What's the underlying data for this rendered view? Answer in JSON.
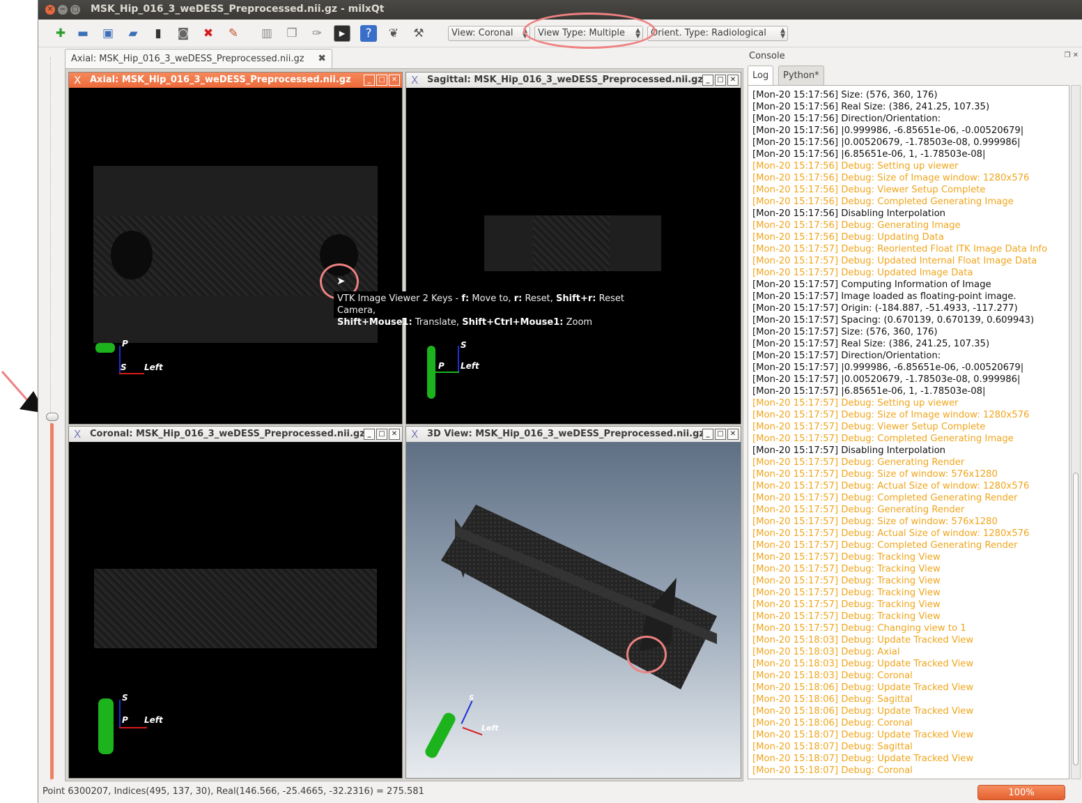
{
  "window": {
    "title": "MSK_Hip_016_3_weDESS_Preprocessed.nii.gz - milxQt"
  },
  "toolbar": {
    "view_combo": "View: Coronal",
    "view_type_combo": "View Type: Multiple",
    "orient_combo": "Orient. Type: Radiological"
  },
  "doc_tab": {
    "label": "Axial: MSK_Hip_016_3_weDESS_Preprocessed.nii.gz"
  },
  "panes": {
    "axial": {
      "title": "Axial: MSK_Hip_016_3_weDESS_Preprocessed.nii.gz",
      "lbl_top": "P",
      "lbl_left": "S",
      "lbl_right": "Left"
    },
    "sagittal": {
      "title": "Sagittal: MSK_Hip_016_3_weDESS_Preprocessed.nii.gz",
      "lbl_top": "S",
      "lbl_left": "P",
      "lbl_right": "Left"
    },
    "coronal": {
      "title": "Coronal: MSK_Hip_016_3_weDESS_Preprocessed.nii.gz",
      "lbl_top": "S",
      "lbl_left": "P",
      "lbl_right": "Left"
    },
    "view3d": {
      "title": "3D View: MSK_Hip_016_3_weDESS_Preprocessed.nii.gz",
      "lbl_top": "S",
      "lbl_right": "Left"
    }
  },
  "tooltip": {
    "p1": "VTK Image Viewer 2 Keys - ",
    "k1": "f:",
    "t1": " Move to, ",
    "k2": "r:",
    "t2": " Reset, ",
    "k3": "Shift+r:",
    "t3": " Reset Camera,",
    "k4": "Shift+Mouse1:",
    "t4": " Translate, ",
    "k5": "Shift+Ctrl+Mouse1:",
    "t5": " Zoom"
  },
  "console": {
    "title": "Console",
    "tabs": [
      "Log",
      "Python*"
    ],
    "lines": [
      {
        "text": "[Mon-20 15:17:56] Size: (576, 360, 176)",
        "type": "info"
      },
      {
        "text": "[Mon-20 15:17:56] Real Size: (386, 241.25, 107.35)",
        "type": "info"
      },
      {
        "text": "[Mon-20 15:17:56] Direction/Orientation:",
        "type": "info"
      },
      {
        "text": "[Mon-20 15:17:56] |0.999986, -6.85651e-06, -0.00520679|",
        "type": "info"
      },
      {
        "text": "[Mon-20 15:17:56] |0.00520679, -1.78503e-08, 0.999986|",
        "type": "info"
      },
      {
        "text": "[Mon-20 15:17:56] |6.85651e-06, 1, -1.78503e-08|",
        "type": "info"
      },
      {
        "text": "[Mon-20 15:17:56] Debug: Setting up viewer",
        "type": "debug"
      },
      {
        "text": "[Mon-20 15:17:56] Debug: Size of Image window: 1280x576",
        "type": "debug"
      },
      {
        "text": "[Mon-20 15:17:56] Debug: Viewer Setup Complete",
        "type": "debug"
      },
      {
        "text": "[Mon-20 15:17:56] Debug: Completed Generating Image",
        "type": "debug"
      },
      {
        "text": "[Mon-20 15:17:56] Disabling Interpolation",
        "type": "info"
      },
      {
        "text": "[Mon-20 15:17:56] Debug: Generating Image",
        "type": "debug"
      },
      {
        "text": "[Mon-20 15:17:56] Debug: Updating Data",
        "type": "debug"
      },
      {
        "text": "[Mon-20 15:17:57] Debug: Reoriented Float ITK Image Data Info",
        "type": "debug"
      },
      {
        "text": "[Mon-20 15:17:57] Debug: Updated Internal Float Image Data",
        "type": "debug"
      },
      {
        "text": "[Mon-20 15:17:57] Debug: Updated Image Data",
        "type": "debug"
      },
      {
        "text": "[Mon-20 15:17:57] Computing Information of Image",
        "type": "info"
      },
      {
        "text": "[Mon-20 15:17:57] Image loaded as floating-point image.",
        "type": "info"
      },
      {
        "text": "[Mon-20 15:17:57] Origin: (-184.887, -51.4933, -117.277)",
        "type": "info"
      },
      {
        "text": "[Mon-20 15:17:57] Spacing: (0.670139, 0.670139, 0.609943)",
        "type": "info"
      },
      {
        "text": "[Mon-20 15:17:57] Size: (576, 360, 176)",
        "type": "info"
      },
      {
        "text": "[Mon-20 15:17:57] Real Size: (386, 241.25, 107.35)",
        "type": "info"
      },
      {
        "text": "[Mon-20 15:17:57] Direction/Orientation:",
        "type": "info"
      },
      {
        "text": "[Mon-20 15:17:57] |0.999986, -6.85651e-06, -0.00520679|",
        "type": "info"
      },
      {
        "text": "[Mon-20 15:17:57] |0.00520679, -1.78503e-08, 0.999986|",
        "type": "info"
      },
      {
        "text": "[Mon-20 15:17:57] |6.85651e-06, 1, -1.78503e-08|",
        "type": "info"
      },
      {
        "text": "[Mon-20 15:17:57] Debug: Setting up viewer",
        "type": "debug"
      },
      {
        "text": "[Mon-20 15:17:57] Debug: Size of Image window: 1280x576",
        "type": "debug"
      },
      {
        "text": "[Mon-20 15:17:57] Debug: Viewer Setup Complete",
        "type": "debug"
      },
      {
        "text": "[Mon-20 15:17:57] Debug: Completed Generating Image",
        "type": "debug"
      },
      {
        "text": "[Mon-20 15:17:57] Disabling Interpolation",
        "type": "info"
      },
      {
        "text": "[Mon-20 15:17:57] Debug: Generating Render",
        "type": "debug"
      },
      {
        "text": "[Mon-20 15:17:57] Debug: Size of window: 576x1280",
        "type": "debug"
      },
      {
        "text": "[Mon-20 15:17:57] Debug: Actual Size of window: 1280x576",
        "type": "debug"
      },
      {
        "text": "[Mon-20 15:17:57] Debug: Completed Generating Render",
        "type": "debug"
      },
      {
        "text": "[Mon-20 15:17:57] Debug: Generating Render",
        "type": "debug"
      },
      {
        "text": "[Mon-20 15:17:57] Debug: Size of window: 576x1280",
        "type": "debug"
      },
      {
        "text": "[Mon-20 15:17:57] Debug: Actual Size of window: 1280x576",
        "type": "debug"
      },
      {
        "text": "[Mon-20 15:17:57] Debug: Completed Generating Render",
        "type": "debug"
      },
      {
        "text": "[Mon-20 15:17:57] Debug: Tracking View",
        "type": "debug"
      },
      {
        "text": "[Mon-20 15:17:57] Debug: Tracking View",
        "type": "debug"
      },
      {
        "text": "[Mon-20 15:17:57] Debug: Tracking View",
        "type": "debug"
      },
      {
        "text": "[Mon-20 15:17:57] Debug: Tracking View",
        "type": "debug"
      },
      {
        "text": "[Mon-20 15:17:57] Debug: Tracking View",
        "type": "debug"
      },
      {
        "text": "[Mon-20 15:17:57] Debug: Tracking View",
        "type": "debug"
      },
      {
        "text": "[Mon-20 15:17:57] Debug: Changing view to 1",
        "type": "debug"
      },
      {
        "text": "[Mon-20 15:18:03] Debug: Update Tracked View",
        "type": "debug"
      },
      {
        "text": "[Mon-20 15:18:03] Debug: Axial",
        "type": "debug"
      },
      {
        "text": "[Mon-20 15:18:03] Debug: Update Tracked View",
        "type": "debug"
      },
      {
        "text": "[Mon-20 15:18:03] Debug: Coronal",
        "type": "debug"
      },
      {
        "text": "[Mon-20 15:18:06] Debug: Update Tracked View",
        "type": "debug"
      },
      {
        "text": "[Mon-20 15:18:06] Debug: Sagittal",
        "type": "debug"
      },
      {
        "text": "[Mon-20 15:18:06] Debug: Update Tracked View",
        "type": "debug"
      },
      {
        "text": "[Mon-20 15:18:06] Debug: Coronal",
        "type": "debug"
      },
      {
        "text": "[Mon-20 15:18:07] Debug: Update Tracked View",
        "type": "debug"
      },
      {
        "text": "[Mon-20 15:18:07] Debug: Sagittal",
        "type": "debug"
      },
      {
        "text": "[Mon-20 15:18:07] Debug: Update Tracked View",
        "type": "debug"
      },
      {
        "text": "[Mon-20 15:18:07] Debug: Coronal",
        "type": "debug"
      }
    ]
  },
  "status": {
    "text": "Point 6300207, Indices(495, 137, 30), Real(146.566, -25.4665, -32.2316) = 275.581",
    "progress": "100%",
    "progress_value": 1.0
  },
  "colors": {
    "accent": "#ec6a3a",
    "debug_text": "#f0a51c",
    "annotation": "#ee8181"
  }
}
